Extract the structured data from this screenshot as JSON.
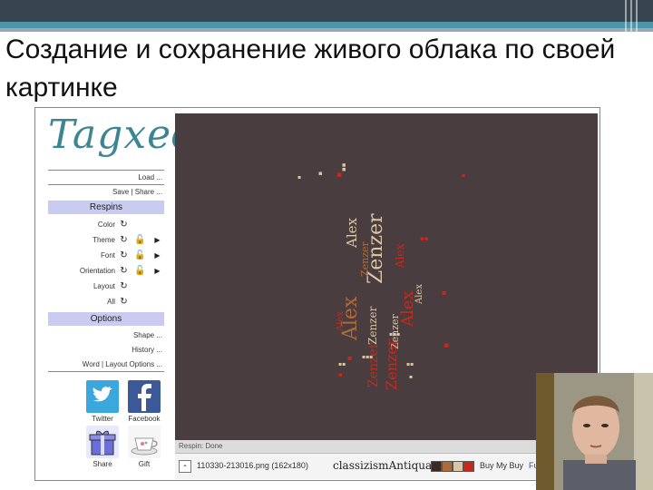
{
  "slide": {
    "title": "Создание и сохранение живого облака по своей картинке"
  },
  "app": {
    "logo": "Tagxedo",
    "links": {
      "load": "Load ...",
      "save_share": "Save | Share ..."
    },
    "respins": {
      "header": "Respins",
      "items": [
        {
          "label": "Color",
          "lock": false,
          "play": false
        },
        {
          "label": "Theme",
          "lock": true,
          "play": true
        },
        {
          "label": "Font",
          "lock": true,
          "play": true
        },
        {
          "label": "Orientation",
          "lock": true,
          "play": true
        },
        {
          "label": "Layout",
          "lock": false,
          "play": false
        },
        {
          "label": "All",
          "lock": false,
          "play": false
        }
      ]
    },
    "options": {
      "header": "Options",
      "shape": "Shape ...",
      "history": "History ...",
      "word_layout": "Word | Layout Options ..."
    },
    "social": {
      "twitter": "Twitter",
      "facebook": "Facebook",
      "share": "Share",
      "gift": "Gift"
    },
    "status": "Respin: Done",
    "toolbar": {
      "checkbox": "-",
      "file": "110330-213016.png (162x180)",
      "font": "classizismAntiqua",
      "swatches": [
        "#3a2a22",
        "#b06a3a",
        "#d8c6a4",
        "#c22a1e"
      ],
      "buy": "Buy My Buy",
      "fullscreen": "FullScr"
    },
    "colors": {
      "canvas_bg": "#4a3d3f",
      "accent": "#3d8590",
      "section_bg": "#c9ccf0"
    }
  },
  "cloud": {
    "words": [
      "Alex",
      "Zenzer",
      "Alex",
      "Zenzer",
      "Alex",
      "Zenzer",
      "Alex",
      "Zenzer",
      "Alex",
      "Alex",
      "Zenzer",
      "Zenzer"
    ]
  }
}
